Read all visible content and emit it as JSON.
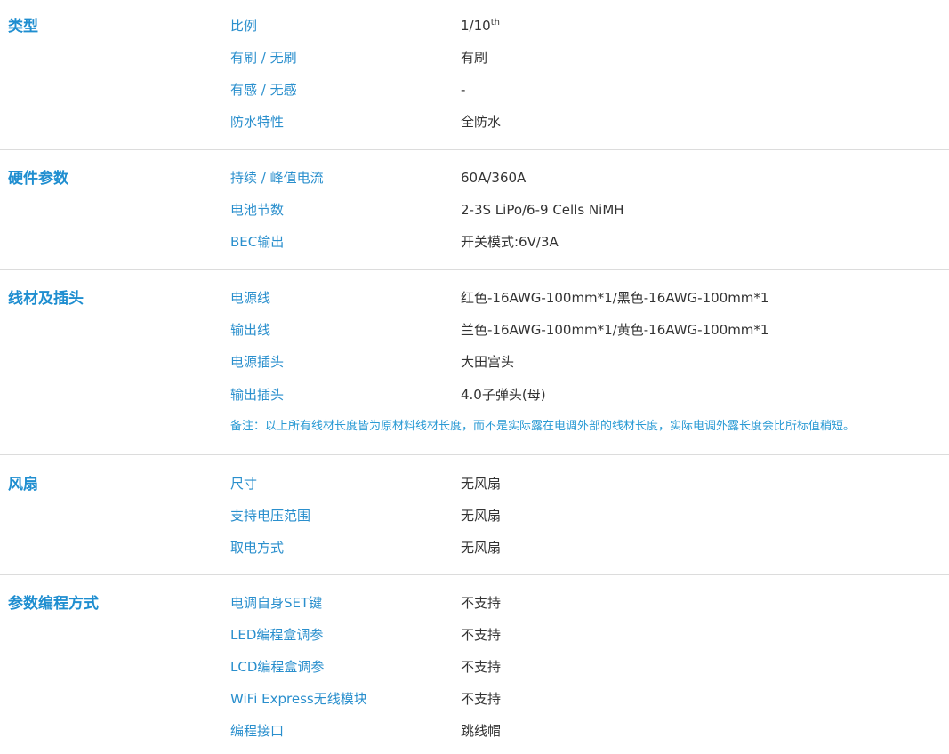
{
  "sections": [
    {
      "title": "类型",
      "rows": [
        {
          "label": "比例",
          "value": "1/10",
          "value_sup": "th"
        },
        {
          "label": "有刷 / 无刷",
          "value": "有刷"
        },
        {
          "label": "有感 / 无感",
          "value": "-"
        },
        {
          "label": "防水特性",
          "value": "全防水"
        }
      ]
    },
    {
      "title": "硬件参数",
      "rows": [
        {
          "label": "持续 / 峰值电流",
          "value": "60A/360A"
        },
        {
          "label": "电池节数",
          "value": "2-3S LiPo/6-9 Cells NiMH"
        },
        {
          "label": "BEC输出",
          "value": "开关模式:6V/3A"
        }
      ]
    },
    {
      "title": "线材及插头",
      "rows": [
        {
          "label": "电源线",
          "value": "红色-16AWG-100mm*1/黑色-16AWG-100mm*1"
        },
        {
          "label": "输出线",
          "value": "兰色-16AWG-100mm*1/黄色-16AWG-100mm*1"
        },
        {
          "label": "电源插头",
          "value": "大田宫头"
        },
        {
          "label": "输出插头",
          "value": "4.0子弹头(母)"
        }
      ],
      "note": "备注：以上所有线材长度皆为原材料线材长度，而不是实际露在电调外部的线材长度，实际电调外露长度会比所标值稍短。"
    },
    {
      "title": "风扇",
      "rows": [
        {
          "label": "尺寸",
          "value": "无风扇"
        },
        {
          "label": "支持电压范围",
          "value": "无风扇"
        },
        {
          "label": "取电方式",
          "value": "无风扇"
        }
      ]
    },
    {
      "title": "参数编程方式",
      "rows": [
        {
          "label": "电调自身SET键",
          "value": "不支持"
        },
        {
          "label": "LED编程盒调参",
          "value": "不支持"
        },
        {
          "label": "LCD编程盒调参",
          "value": "不支持"
        },
        {
          "label": "WiFi Express无线模块",
          "value": "不支持"
        },
        {
          "label": "编程接口",
          "value": "跳线帽"
        }
      ]
    }
  ],
  "colors": {
    "section_title": "#1f8ed0",
    "label": "#2a8fcd",
    "value": "#333333",
    "note": "#2a9ad4",
    "divider": "#dcdcdc"
  }
}
